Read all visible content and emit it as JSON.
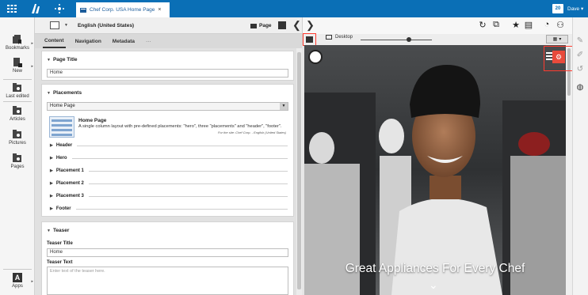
{
  "topbar": {
    "home_icon": "grid-icon",
    "logo_icon": "brand-logo-icon",
    "nav_icon": "tree-nav-icon",
    "tab": {
      "label": "Chef Corp. USA Home Page",
      "close": "×"
    },
    "notification_count": "20",
    "user": "Dave ▾"
  },
  "sidebar": {
    "items": [
      {
        "label": "Bookmarks",
        "icon": "bookmark-icon",
        "has_arrow": true
      },
      {
        "label": "New",
        "icon": "new-doc-icon",
        "has_arrow": true
      },
      {
        "label": "Last edited",
        "icon": "folder-search-icon"
      },
      {
        "label": "Articles",
        "icon": "folder-search-icon"
      },
      {
        "label": "Pictures",
        "icon": "folder-search-icon"
      },
      {
        "label": "Pages",
        "icon": "folder-search-icon"
      }
    ],
    "apps": {
      "label": "Apps",
      "icon": "apps-icon",
      "glyph": "A",
      "arrow": "▸"
    }
  },
  "editor": {
    "locale": "English (United States)",
    "page_label": "Page",
    "collapse_glyph": "❮",
    "tabs": [
      {
        "label": "Content",
        "active": true
      },
      {
        "label": "Navigation",
        "active": false
      },
      {
        "label": "Metadata",
        "active": false
      },
      {
        "label": "···",
        "active": false
      }
    ],
    "page_title_section": {
      "title": "Page Title",
      "value": "Home"
    },
    "placements_section": {
      "title": "Placements",
      "selected_layout": "Home Page",
      "layout_name": "Home Page",
      "layout_desc": "A single column layout with pre-defined placements: \"hero\", three \"placements\" and \"header\", \"footer\".",
      "layout_site": "For the site: Chef Corp. - English (United States)",
      "rows": [
        "Header",
        "Hero",
        "Placement 1",
        "Placement 2",
        "Placement 3",
        "Footer"
      ]
    },
    "teaser_section": {
      "title": "Teaser",
      "teaser_title_label": "Teaser Title",
      "teaser_title_value": "Home",
      "teaser_text_label": "Teaser Text",
      "teaser_text_placeholder": "Enter text of the teaser here."
    }
  },
  "preview": {
    "expand_glyph": "❯",
    "device_label": "Desktop",
    "device_slider_level": 0.65,
    "headline": "Great Appliances For Every Chef",
    "down_glyph": "⌄",
    "edit_glyph": "⚙",
    "toolbar_icons": [
      "reload-icon",
      "open-external-icon",
      "star-icon",
      "chart-icon",
      "history-icon",
      "users-icon"
    ]
  },
  "right_rail": {
    "icons": [
      "pen-icon",
      "pencil-icon",
      "refresh-icon",
      "globe-icon"
    ]
  },
  "colors": {
    "topbar": "#0a6fb6",
    "accent_red": "#e84b3c",
    "highlight_outline": "#ff3b2f"
  }
}
